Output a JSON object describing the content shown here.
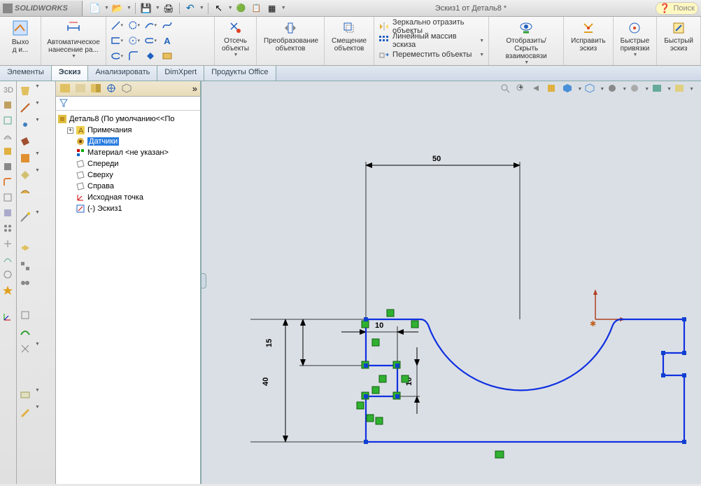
{
  "app": {
    "name": "SOLIDWORKS",
    "doc_title": "Эскиз1 от Деталь8 *",
    "search_placeholder": "Поиск"
  },
  "ribbon": {
    "exit": "Выхо\nд и...",
    "auto_dim": "Автоматическое\nнанесение ра...",
    "trim": "Отсечь\nобъекты",
    "convert": "Преобразование\nобъектов",
    "offset": "Смещение\nобъектов",
    "mirror": "Зеркально отразить объекты",
    "linear_pattern": "Линейный массив эскиза",
    "move": "Переместить объекты",
    "display_relations": "Отобразить/Скрыть\nвзаимосвязи",
    "repair": "Исправить\nэскиз",
    "quick_snaps": "Быстрые\nпривязки",
    "rapid_sketch": "Быстрый\nэскиз"
  },
  "tabs": {
    "features": "Элементы",
    "sketch": "Эскиз",
    "evaluate": "Анализировать",
    "dimxpert": "DimXpert",
    "office": "Продукты Office"
  },
  "tree": {
    "root": "Деталь8  (По умолчанию<<По",
    "annotations": "Примечания",
    "sensors": "Датчики",
    "material": "Материал <не указан>",
    "front": "Спереди",
    "top": "Сверху",
    "right": "Справа",
    "origin": "Исходная точка",
    "sketch1": "(-) Эскиз1"
  },
  "dims": {
    "d50": "50",
    "d40": "40",
    "d15": "15",
    "d10a": "10",
    "d10b": "10"
  }
}
